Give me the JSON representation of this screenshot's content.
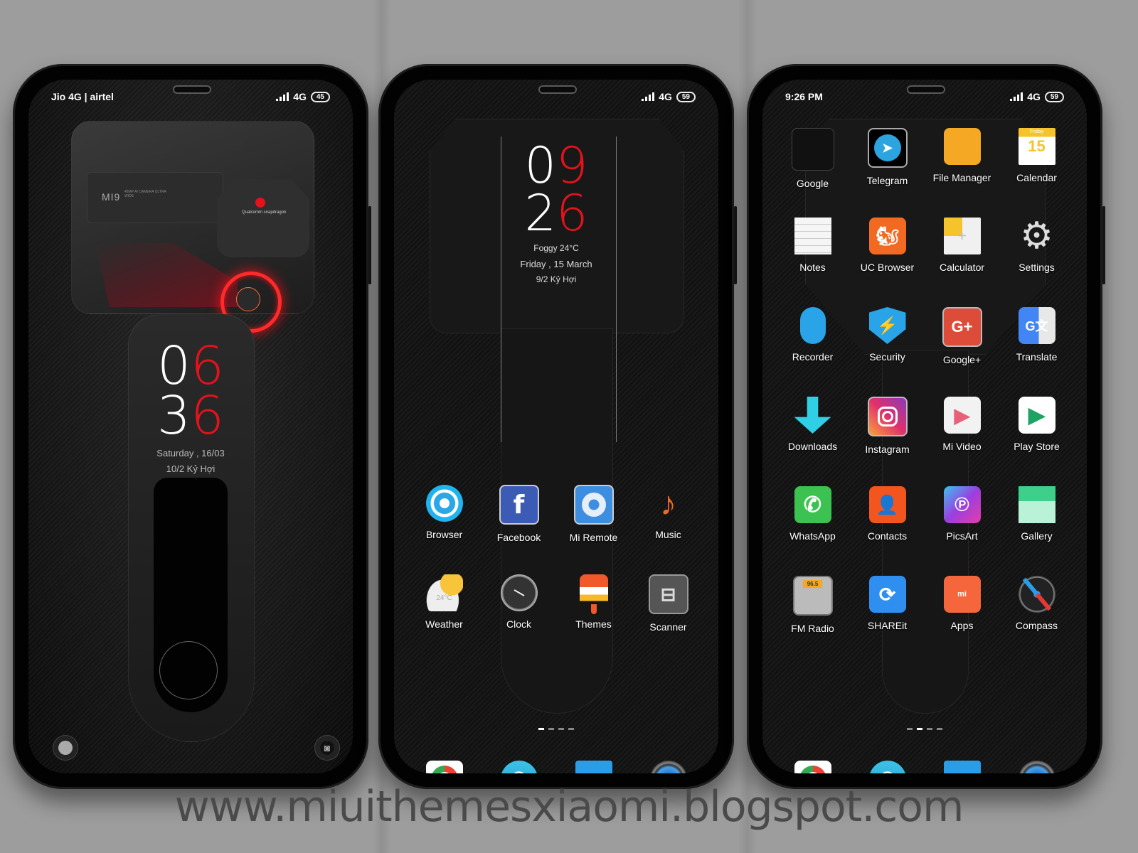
{
  "watermark": "www.miuithemesxiaomi.blogspot.com",
  "colors": {
    "accent_red": "#e3121b",
    "background": "#9d9d9d"
  },
  "lockscreen": {
    "status": {
      "carrier": "Jio 4G | airtel",
      "network": "4G",
      "battery": "45"
    },
    "clock": {
      "hour_a": "0",
      "hour_b": "6",
      "min_a": "3",
      "min_b": "6"
    },
    "date": "Saturday , 16/03",
    "lunar_date": "10/2 Kỷ Hợi",
    "branding": {
      "model": "MI9",
      "model_sub": "48MP AI CAMERA ULTRA WIDE",
      "chip": "Qualcomm snapdragon"
    },
    "shortcuts": {
      "left": "TOOL",
      "right": "CAMERA"
    }
  },
  "home1": {
    "status": {
      "network": "4G",
      "battery": "59"
    },
    "clock": {
      "hour_a": "0",
      "hour_b": "9",
      "min_a": "2",
      "min_b": "6"
    },
    "weather": "Foggy 24°C",
    "date": "Friday , 15 March",
    "lunar_date": "9/2 Kỷ Hợi",
    "apps": [
      {
        "label": "Browser",
        "icon": "browser-icon"
      },
      {
        "label": "Facebook",
        "icon": "facebook-icon"
      },
      {
        "label": "Mi Remote",
        "icon": "mi-remote-icon"
      },
      {
        "label": "Music",
        "icon": "music-icon"
      },
      {
        "label": "Weather",
        "icon": "weather-icon",
        "badge": "24°C"
      },
      {
        "label": "Clock",
        "icon": "clock-icon"
      },
      {
        "label": "Themes",
        "icon": "themes-icon"
      },
      {
        "label": "Scanner",
        "icon": "scanner-icon"
      }
    ],
    "pages": {
      "count": 4,
      "active": 1
    },
    "dock": [
      "chrome-icon",
      "phone-icon",
      "messages-icon",
      "camera-icon"
    ]
  },
  "home2": {
    "status": {
      "time": "9:26 PM",
      "network": "4G",
      "battery": "59"
    },
    "apps": [
      {
        "label": "Google",
        "icon": "google-folder-icon"
      },
      {
        "label": "Telegram",
        "icon": "telegram-icon"
      },
      {
        "label": "File Manager",
        "icon": "file-manager-icon"
      },
      {
        "label": "Calendar",
        "icon": "calendar-icon",
        "day": "Friday",
        "date": "15"
      },
      {
        "label": "Notes",
        "icon": "notes-icon"
      },
      {
        "label": "UC Browser",
        "icon": "uc-browser-icon"
      },
      {
        "label": "Calculator",
        "icon": "calculator-icon"
      },
      {
        "label": "Settings",
        "icon": "settings-icon"
      },
      {
        "label": "Recorder",
        "icon": "recorder-icon"
      },
      {
        "label": "Security",
        "icon": "security-icon"
      },
      {
        "label": "Google+",
        "icon": "google-plus-icon",
        "glyph": "G+"
      },
      {
        "label": "Translate",
        "icon": "translate-icon",
        "glyph": "G文"
      },
      {
        "label": "Downloads",
        "icon": "downloads-icon"
      },
      {
        "label": "Instagram",
        "icon": "instagram-icon"
      },
      {
        "label": "Mi Video",
        "icon": "mi-video-icon"
      },
      {
        "label": "Play Store",
        "icon": "play-store-icon"
      },
      {
        "label": "WhatsApp",
        "icon": "whatsapp-icon"
      },
      {
        "label": "Contacts",
        "icon": "contacts-icon"
      },
      {
        "label": "PicsArt",
        "icon": "picsart-icon"
      },
      {
        "label": "Gallery",
        "icon": "gallery-icon"
      },
      {
        "label": "FM Radio",
        "icon": "fm-radio-icon",
        "freq": "96.5"
      },
      {
        "label": "SHAREit",
        "icon": "shareit-icon"
      },
      {
        "label": "Apps",
        "icon": "mi-apps-icon",
        "glyph": "mi"
      },
      {
        "label": "Compass",
        "icon": "compass-icon"
      }
    ],
    "pages": {
      "count": 4,
      "active": 2
    },
    "dock": [
      "chrome-icon",
      "phone-icon",
      "messages-icon",
      "camera-icon"
    ]
  }
}
